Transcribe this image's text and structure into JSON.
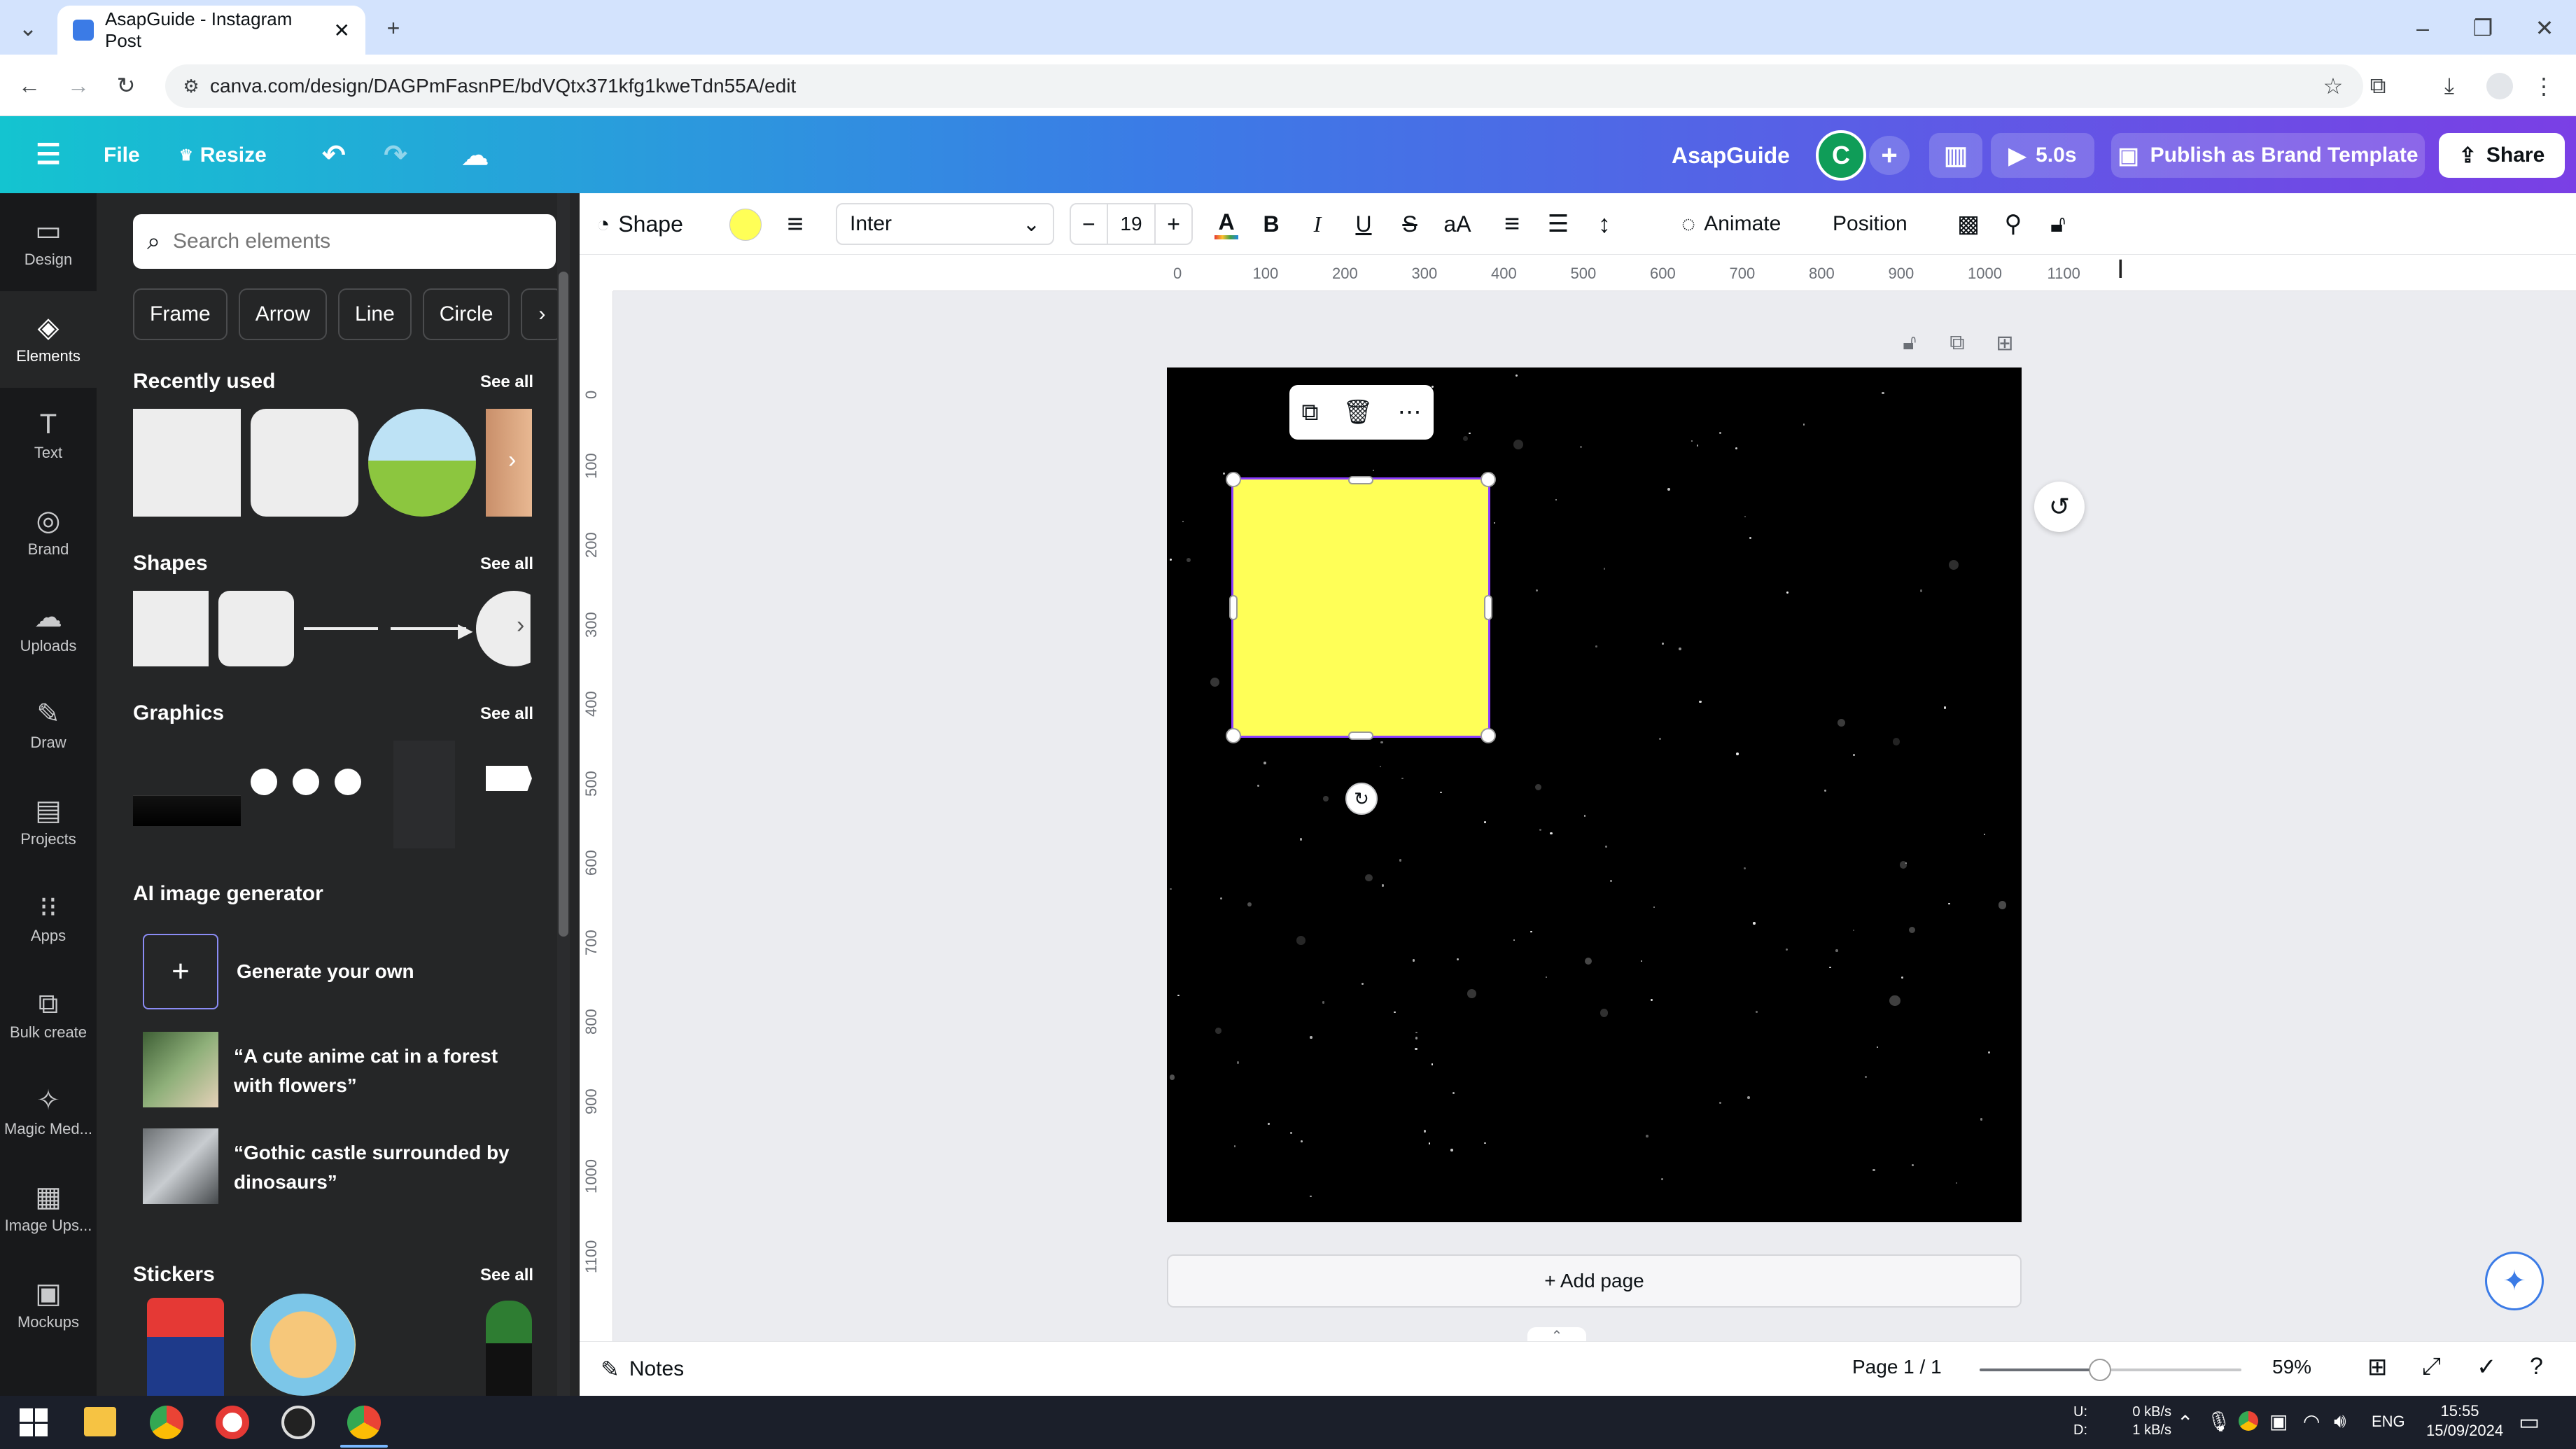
{
  "browser": {
    "tab_title": "AsapGuide - Instagram Post",
    "url": "canva.com/design/DAGPmFasnPE/bdVQtx371kfg1kweTdn55A/edit",
    "icons": [
      "tab-search-icon",
      "canva-favicon",
      "close-tab-icon",
      "new-tab-icon",
      "back-icon",
      "forward-icon",
      "reload-icon",
      "site-info-icon",
      "bookmark-star-icon",
      "extensions-icon",
      "download-icon",
      "profile-icon",
      "more-vert-icon",
      "minimize-icon",
      "restore-icon",
      "close-window-icon"
    ]
  },
  "header": {
    "file": "File",
    "resize": "Resize",
    "team_name": "AsapGuide",
    "avatar_letter": "C",
    "play_duration": "5.0s",
    "publish": "Publish as Brand Template",
    "share": "Share"
  },
  "rail": {
    "items": [
      {
        "label": "Design",
        "icon": "design-icon"
      },
      {
        "label": "Elements",
        "icon": "elements-icon"
      },
      {
        "label": "Text",
        "icon": "text-icon"
      },
      {
        "label": "Brand",
        "icon": "brand-icon"
      },
      {
        "label": "Uploads",
        "icon": "uploads-icon"
      },
      {
        "label": "Draw",
        "icon": "draw-icon"
      },
      {
        "label": "Projects",
        "icon": "projects-icon"
      },
      {
        "label": "Apps",
        "icon": "apps-icon"
      },
      {
        "label": "Bulk create",
        "icon": "bulk-create-icon"
      },
      {
        "label": "Magic Med...",
        "icon": "magic-media-icon"
      },
      {
        "label": "Image Ups...",
        "icon": "image-upscaler-icon"
      },
      {
        "label": "Mockups",
        "icon": "mockups-icon"
      }
    ]
  },
  "panel": {
    "search_placeholder": "Search elements",
    "chips": [
      "Frame",
      "Arrow",
      "Line",
      "Circle"
    ],
    "recently_used": "Recently used",
    "shapes": "Shapes",
    "graphics": "Graphics",
    "ai_generator": "AI image generator",
    "generate_own": "Generate your own",
    "prompt1": "“A cute anime cat in a forest with flowers”",
    "prompt2": "“Gothic castle surrounded by dinosaurs”",
    "stickers": "Stickers",
    "see_all": "See all"
  },
  "toolbar": {
    "shape": "Shape",
    "font": "Inter",
    "font_size": "19",
    "animate": "Animate",
    "position": "Position",
    "fill_color": "#ffff57"
  },
  "rulers": {
    "top": [
      "0",
      "100",
      "200",
      "300",
      "400",
      "500",
      "600",
      "700",
      "800",
      "900",
      "1000",
      "1100"
    ],
    "left": [
      "0",
      "100",
      "200",
      "300",
      "400",
      "500",
      "600",
      "700",
      "800",
      "900",
      "1000",
      "1100"
    ]
  },
  "canvas": {
    "add_page": "+ Add page",
    "page_bg": "#000000",
    "accent": "#8b3dff"
  },
  "status": {
    "notes": "Notes",
    "page": "Page 1 / 1",
    "zoom": "59%",
    "zoom_level": 0.46
  },
  "taskbar": {
    "net_up_label": "U:",
    "net_down_label": "D:",
    "net_up": "0 kB/s",
    "net_down": "1 kB/s",
    "lang": "ENG",
    "time": "15:55",
    "date": "15/09/2024"
  }
}
